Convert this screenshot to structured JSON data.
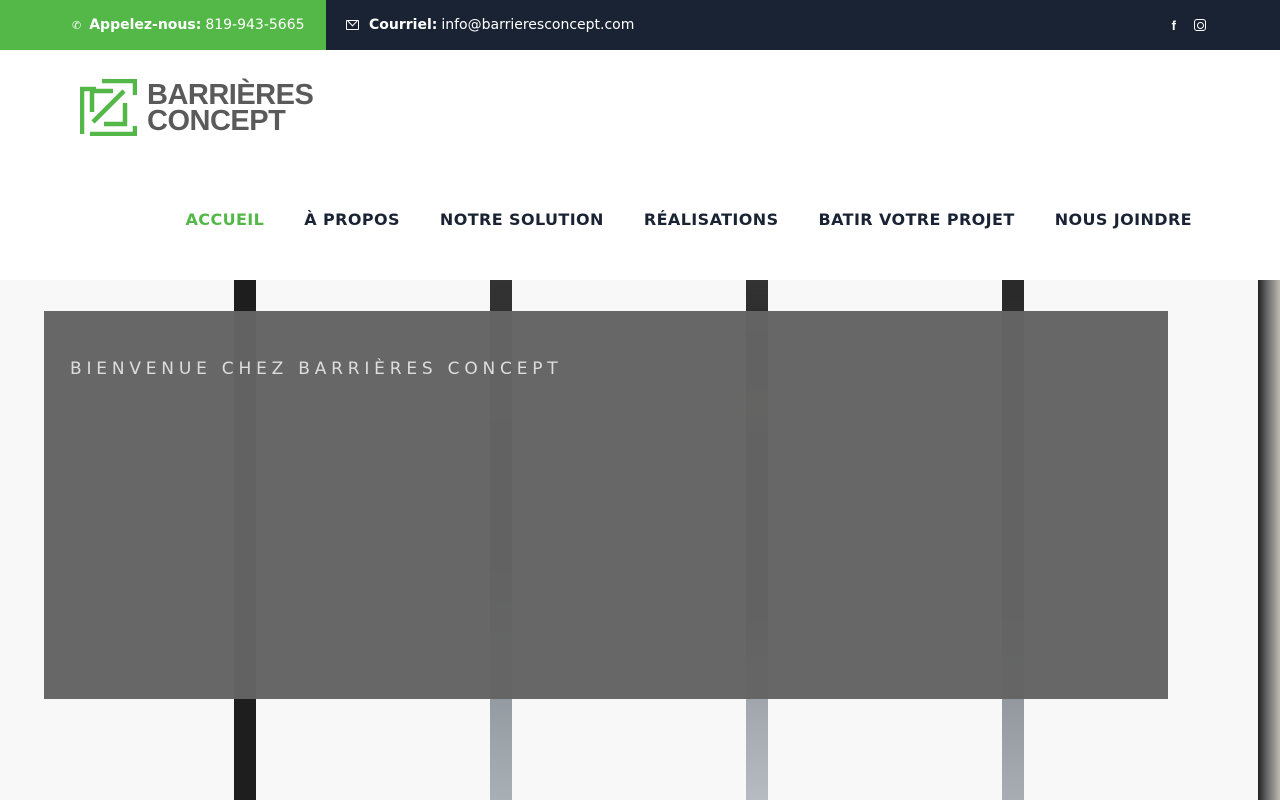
{
  "topbar": {
    "phone_label": "Appelez-nous:",
    "phone_number": "819-943-5665",
    "email_label": "Courriel:",
    "email_value": "info@barrieresconcept.com",
    "social": [
      "facebook-icon",
      "instagram-icon"
    ]
  },
  "logo": {
    "line1": "BARRIÈRES",
    "line2": "CONCEPT",
    "colors": {
      "mark": "#54b848",
      "text": "#5a5a5a"
    }
  },
  "nav": {
    "items": [
      {
        "label": "ACCUEIL",
        "active": true
      },
      {
        "label": "À PROPOS"
      },
      {
        "label": "NOTRE SOLUTION"
      },
      {
        "label": "RÉALISATIONS"
      },
      {
        "label": "BATIR VOTRE PROJET"
      },
      {
        "label": "NOUS JOINDRE"
      }
    ]
  },
  "hero": {
    "welcome": "BIENVENUE CHEZ BARRIÈRES CONCEPT"
  },
  "colors": {
    "accent": "#54b848",
    "dark": "#1a2333",
    "overlay": "#646464"
  }
}
